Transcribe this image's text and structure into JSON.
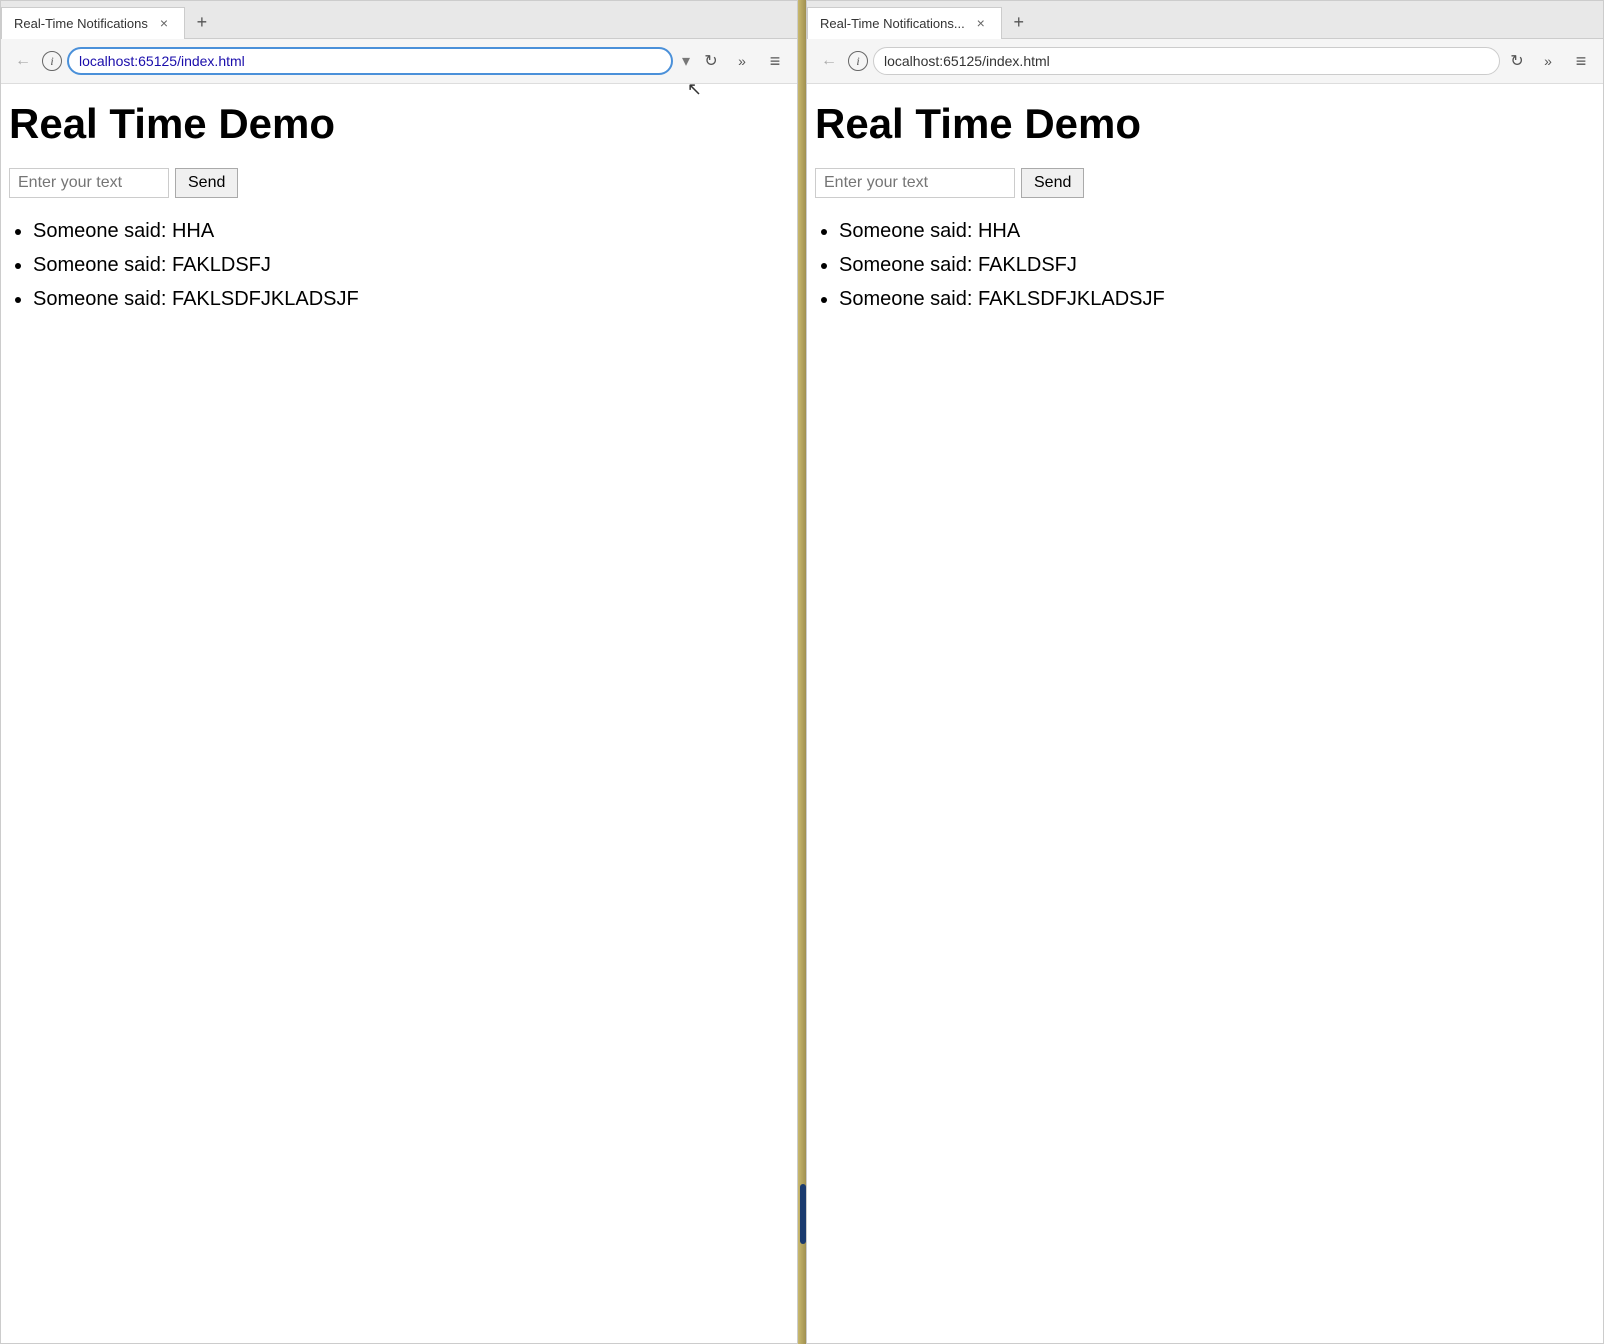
{
  "browser1": {
    "tab": {
      "title": "Real-Time Notifications",
      "close_label": "×",
      "new_tab_label": "+"
    },
    "address_bar": {
      "url": "localhost:65125/index.html",
      "back_label": "←",
      "forward_label": "→",
      "info_label": "i",
      "reload_label": "↻",
      "extensions_label": "»",
      "menu_label": "≡"
    },
    "page": {
      "title": "Real Time Demo",
      "input_placeholder": "Enter your text",
      "send_button": "Send",
      "messages": [
        "Someone said: HHA",
        "Someone said: FAKLDSFJ",
        "Someone said: FAKLSDFJKLADSJF"
      ]
    }
  },
  "browser2": {
    "tab": {
      "title": "Real-Time Notifications...",
      "close_label": "×",
      "new_tab_label": "+"
    },
    "address_bar": {
      "url": "localhost:65125/index.html",
      "back_label": "←",
      "forward_label": "→",
      "info_label": "i",
      "reload_label": "↻",
      "extensions_label": "»",
      "menu_label": "≡"
    },
    "page": {
      "title": "Real Time Demo",
      "input_placeholder": "Enter your text",
      "send_button": "Send",
      "messages": [
        "Someone said: HHA",
        "Someone said: FAKLDSFJ",
        "Someone said: FAKLSDFJKLADSJF"
      ]
    }
  }
}
